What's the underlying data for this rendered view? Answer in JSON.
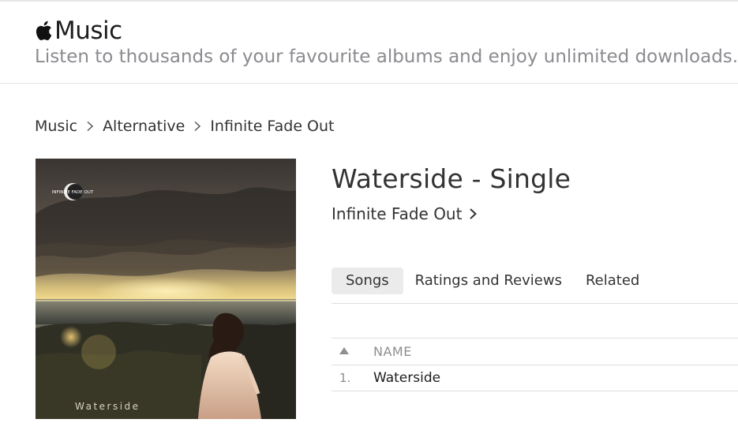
{
  "header": {
    "brand_name": "Music",
    "tagline": "Listen to thousands of your favourite albums and enjoy unlimited downloads."
  },
  "breadcrumb": {
    "items": [
      "Music",
      "Alternative",
      "Infinite Fade Out"
    ]
  },
  "album": {
    "title": "Waterside - Single",
    "artist": "Infinite Fade Out",
    "artwork": {
      "logo_text": "INFINITE FADE OUT",
      "caption": "Waterside"
    }
  },
  "tabs": [
    {
      "label": "Songs",
      "active": true
    },
    {
      "label": "Ratings and Reviews",
      "active": false
    },
    {
      "label": "Related",
      "active": false
    }
  ],
  "songs": {
    "column_name": "NAME",
    "sort_icon": "sort-ascending-icon",
    "rows": [
      {
        "number": "1.",
        "name": "Waterside"
      }
    ]
  }
}
